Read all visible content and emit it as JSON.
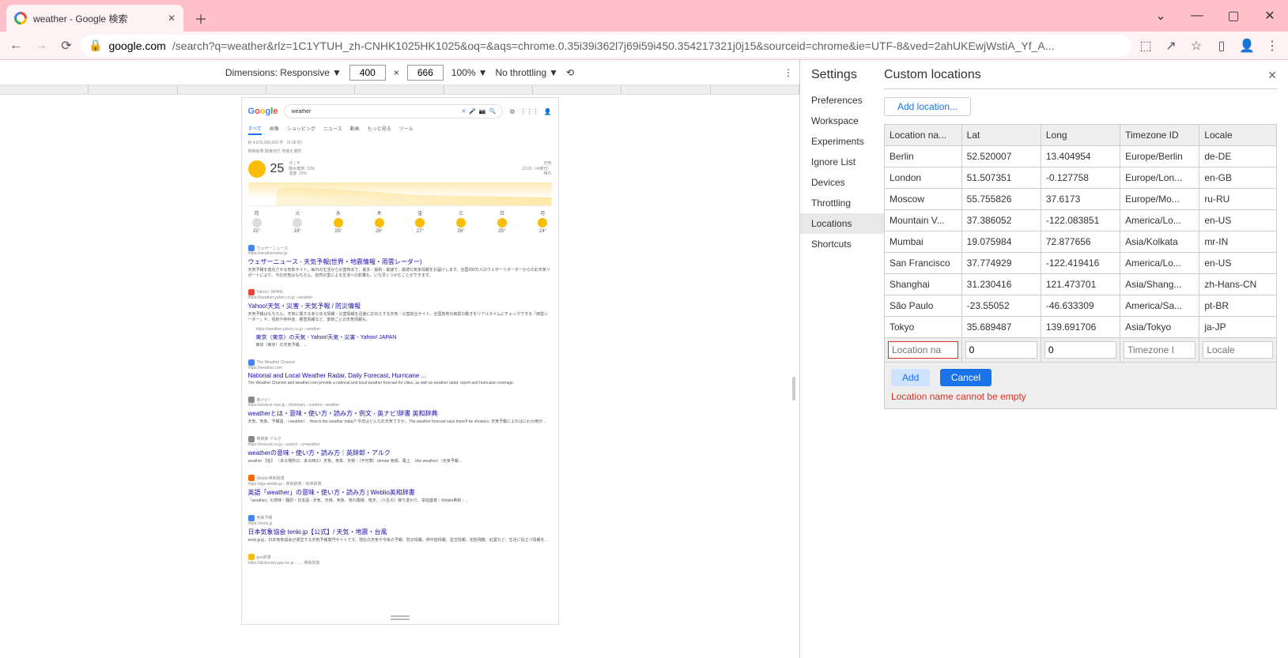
{
  "browser": {
    "tab_title": "weather - Google 検索",
    "url_host": "google.com",
    "url_rest": "/search?q=weather&rlz=1C1YTUH_zh-CNHK1025HK1025&oq=&aqs=chrome.0.35i39i362l7j69i59i450.354217321j0j15&sourceid=chrome&ie=UTF-8&ved=2ahUKEwjWstiA_Yf_A..."
  },
  "devtoolbar": {
    "dimensions_label": "Dimensions: Responsive",
    "width": "400",
    "height": "666",
    "separator": "×",
    "zoom": "100%",
    "throttling": "No throttling"
  },
  "search_page": {
    "query": "weather",
    "tabs": [
      "すべて",
      "画像",
      "ショッピング",
      "ニュース",
      "動画",
      "もっと見る",
      "ツール"
    ],
    "stats": "約 4,870,000,000 件 （0.38 秒）",
    "location_label": "検索結果 関東地方 地域を選択",
    "weather": {
      "temp": "25",
      "unit": "℃ | ℉",
      "precip": "降水確率: 10%",
      "humidity": "湿度: 23%",
      "wind_label": "天気",
      "time": "12:00（木曜日）",
      "condition": "晴れ"
    },
    "results": [
      {
        "icon": "blue",
        "site": "ウェザーニュース",
        "url": "https://weathernews.jp",
        "title": "ウェザーニュース - 天気予報(世界・地震情報・雨雲レーダー)",
        "desc": "天気予報を進化させる気象サイト。毎日の生活から災害時まで、最多・最新・最速で、最適な気象情報をお届けします。全国200万人のウェザーリポーターからのお天気リポートにより、今の天気はもちろん、自然災害による生活への影響も、いち早くつかむことができます。"
      },
      {
        "icon": "red",
        "site": "Yahoo! JAPAN",
        "url": "https://weather.yahoo.co.jp › weather",
        "title": "Yahoo!天気・災害 - 天気予報 / 防災情報",
        "desc": "天気予報はもちろん、天気に関するあらゆる情報・災害情報を迅速にお伝えする天気・災害総合サイト。全国各地の雨雲の動きをリアルタイムにチェックできる「雨雲レーダー」や、花粉や熱中症、積雪情報など、季節ごとの天気情報も。",
        "sub": {
          "url": "https://weather.yahoo.co.jp › weather",
          "title": "東京（東京）の天気 - Yahoo!天気・災害 - Yahoo! JAPAN",
          "desc": "東京（東京）の天気予報。..."
        }
      },
      {
        "icon": "blue",
        "site": "The Weather Channel",
        "url": "https://weather.com",
        "title": "National and Local Weather Radar, Daily Forecast, Hurricane ...",
        "desc": "The Weather Channel and weather.com provide a national and local weather forecast for cities, as well as weather radar, report and hurricane coverage."
      },
      {
        "icon": "grey",
        "site": "英ナビ！",
        "url": "https://www.ei-navi.jp › dictionary › content › weather",
        "title": "weatherとは・意味・使い方・読み方・例文 - 英ナビ!辞書 英和辞典",
        "desc": "天気、気象、予報語。〔weather〕. How is the weather today? 今日はどんなお天気ですか。The weather forecast says there'll be showers. 天気予報によればにわか雨が..."
      },
      {
        "icon": "grey",
        "site": "英辞郎 アルク",
        "url": "https://eow.alc.co.jp › search › q=weather",
        "title": "weatherの意味・使い方・読み方｜英辞郎・アルク",
        "desc": "weather 【名】 〔ある場所の、ある時の〕天気、気象、天候・〔不可算〕climate 気候、風土、〔the weather〕〔天気予報..."
      },
      {
        "icon": "orange",
        "site": "Weblio英和辞書",
        "url": "https://ejje.weblio.jp › 英和辞典・和英辞典",
        "title": "英語「weather」の意味・使い方・読み方 | Weblio英和辞書",
        "desc": "「weather」の意味・翻訳・日本語 - 天気、天候、気象、荒れ模様、荒天、（人生の）移り変わり、栄枯盛衰｜Weblio英和・..."
      },
      {
        "icon": "blue",
        "site": "気象予報",
        "url": "https://tenki.jp",
        "title": "日本気象協会 tenki.jp【公式】/ 天気・地震・台風",
        "desc": "tenki.jpは、日本気象協会が運営する天気予報専門サイトです。現在の天気や今後の予報、防災情報、熱中症情報、星空情報、花粉飛散、紅葉など、生活に役立つ情報を..."
      },
      {
        "icon": "gold",
        "site": "goo辞書",
        "url": "https://dictionary.goo.ne.jp › ... › 英和辞書",
        "title": "",
        "desc": ""
      }
    ]
  },
  "settings": {
    "heading": "Settings",
    "menu": [
      "Preferences",
      "Workspace",
      "Experiments",
      "Ignore List",
      "Devices",
      "Throttling",
      "Locations",
      "Shortcuts"
    ],
    "menu_active": "Locations",
    "panel_title": "Custom locations",
    "add_location_btn": "Add location...",
    "columns": {
      "name": "Location na...",
      "lat": "Lat",
      "lon": "Long",
      "tz": "Timezone ID",
      "locale": "Locale"
    },
    "locations": [
      {
        "name": "Berlin",
        "lat": "52.520007",
        "lon": "13.404954",
        "tz": "Europe/Berlin",
        "locale": "de-DE"
      },
      {
        "name": "London",
        "lat": "51.507351",
        "lon": "-0.127758",
        "tz": "Europe/Lon...",
        "locale": "en-GB"
      },
      {
        "name": "Moscow",
        "lat": "55.755826",
        "lon": "37.6173",
        "tz": "Europe/Mo...",
        "locale": "ru-RU"
      },
      {
        "name": "Mountain V...",
        "lat": "37.386052",
        "lon": "-122.083851",
        "tz": "America/Lo...",
        "locale": "en-US"
      },
      {
        "name": "Mumbai",
        "lat": "19.075984",
        "lon": "72.877656",
        "tz": "Asia/Kolkata",
        "locale": "mr-IN"
      },
      {
        "name": "San Francisco",
        "lat": "37.774929",
        "lon": "-122.419416",
        "tz": "America/Lo...",
        "locale": "en-US"
      },
      {
        "name": "Shanghai",
        "lat": "31.230416",
        "lon": "121.473701",
        "tz": "Asia/Shang...",
        "locale": "zh-Hans-CN"
      },
      {
        "name": "São Paulo",
        "lat": "-23.55052",
        "lon": "-46.633309",
        "tz": "America/Sa...",
        "locale": "pt-BR"
      },
      {
        "name": "Tokyo",
        "lat": "35.689487",
        "lon": "139.691706",
        "tz": "Asia/Tokyo",
        "locale": "ja-JP"
      }
    ],
    "new_row": {
      "name_placeholder": "Location na",
      "lat_value": "0",
      "lon_value": "0",
      "tz_placeholder": "Timezone I",
      "locale_placeholder": "Locale"
    },
    "add_btn": "Add",
    "cancel_btn": "Cancel",
    "error": "Location name cannot be empty"
  }
}
